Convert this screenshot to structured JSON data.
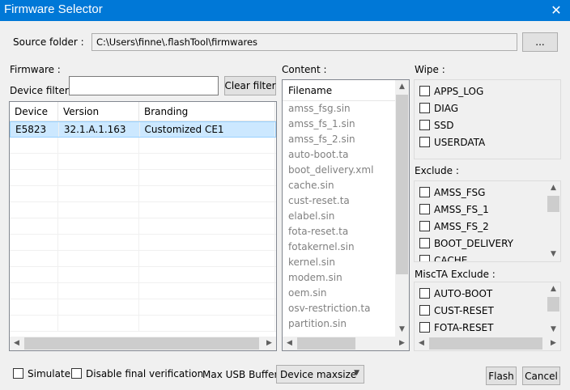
{
  "window": {
    "title": "Firmware Selector",
    "close_glyph": "✕"
  },
  "source": {
    "label": "Source folder :",
    "path": "C:\\Users\\finne\\.flashTool\\firmwares",
    "browse_label": "..."
  },
  "firmware": {
    "section_label": "Firmware :",
    "filter_label": "Device filter :",
    "filter_value": "",
    "clear_filter_label": "Clear filter",
    "columns": [
      "Device",
      "Version",
      "Branding"
    ],
    "rows": [
      {
        "device": "E5823",
        "version": "32.1.A.1.163",
        "branding": "Customized CE1"
      }
    ]
  },
  "content": {
    "section_label": "Content :",
    "header": "Filename",
    "files": [
      "amss_fsg.sin",
      "amss_fs_1.sin",
      "amss_fs_2.sin",
      "auto-boot.ta",
      "boot_delivery.xml",
      "cache.sin",
      "cust-reset.ta",
      "elabel.sin",
      "fota-reset.ta",
      "fotakernel.sin",
      "kernel.sin",
      "modem.sin",
      "oem.sin",
      "osv-restriction.ta",
      "partition.sin"
    ]
  },
  "wipe": {
    "section_label": "Wipe :",
    "items": [
      "APPS_LOG",
      "DIAG",
      "SSD",
      "USERDATA"
    ]
  },
  "exclude": {
    "section_label": "Exclude :",
    "items": [
      "AMSS_FSG",
      "AMSS_FS_1",
      "AMSS_FS_2",
      "BOOT_DELIVERY",
      "CACHE"
    ]
  },
  "miscta": {
    "section_label": "MiscTA Exclude :",
    "items": [
      "AUTO-BOOT",
      "CUST-RESET",
      "FOTA-RESET"
    ]
  },
  "options": {
    "simulate_label": "Simulate",
    "disable_verification_label": "Disable final verification",
    "usb_buffer_label": "Max USB Buffer :",
    "usb_buffer_value": "Device maxsize"
  },
  "actions": {
    "flash_label": "Flash",
    "cancel_label": "Cancel"
  },
  "colors": {
    "titlebar": "#0078d7",
    "selection": "#cce8ff",
    "disabled_text": "#808080"
  }
}
